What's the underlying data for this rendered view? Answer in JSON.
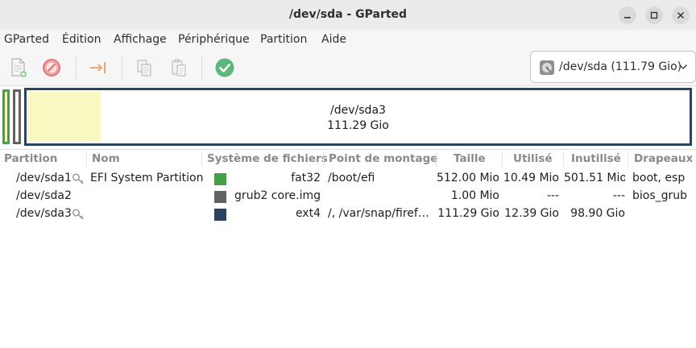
{
  "window": {
    "title": "/dev/sda - GParted"
  },
  "menu": [
    "GParted",
    "Édition",
    "Affichage",
    "Périphérique",
    "Partition",
    "Aide"
  ],
  "device": {
    "label": "/dev/sda (111.79 Gio)"
  },
  "diskmap": {
    "main_name": "/dev/sda3",
    "main_size": "111.29 Gio"
  },
  "table": {
    "headers": [
      "Partition",
      "Nom",
      "Système de fichiers",
      "Point de montage",
      "Taille",
      "Utilisé",
      "Inutilisé",
      "Drapeaux"
    ],
    "rows": [
      {
        "partition": "/dev/sda1",
        "name": "EFI System Partition",
        "fs": "fat32",
        "fs_color": "#43a047",
        "mount": "/boot/efi",
        "size": "512.00 Mio",
        "used": "10.49 Mio",
        "unused": "501.51 Mio",
        "flags": "boot, esp",
        "key": true
      },
      {
        "partition": "/dev/sda2",
        "name": "",
        "fs": "grub2 core.img",
        "fs_color": "#616161",
        "mount": "",
        "size": "1.00 Mio",
        "used": "---",
        "unused": "---",
        "flags": "bios_grub",
        "key": false
      },
      {
        "partition": "/dev/sda3",
        "name": "",
        "fs": "ext4",
        "fs_color": "#2b445e",
        "mount": "/, /var/snap/firef…",
        "size": "111.29 Gio",
        "used": "12.39 Gio",
        "unused": "98.90 Gio",
        "flags": "",
        "key": true
      }
    ]
  }
}
